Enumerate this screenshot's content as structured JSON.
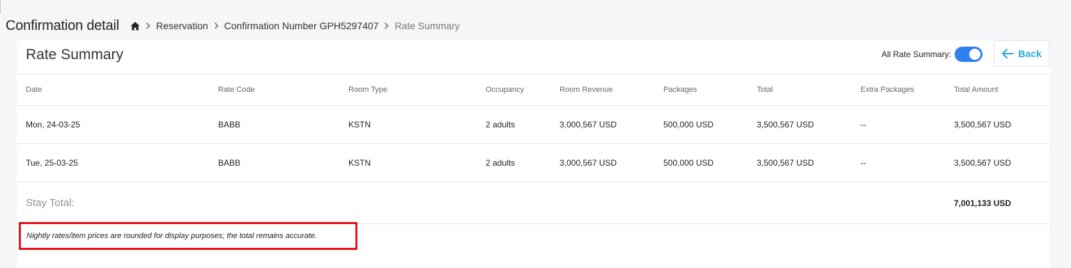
{
  "header": {
    "page_title": "Confirmation detail",
    "breadcrumb": [
      "Reservation",
      "Confirmation Number GPH5297407",
      "Rate Summary"
    ]
  },
  "card": {
    "title": "Rate Summary",
    "toggle_label": "All Rate Summary:",
    "toggle_on": true,
    "back_label": "Back",
    "accent_color": "#2f80ed",
    "back_color": "#29a8e0"
  },
  "table": {
    "columns": [
      "Date",
      "Rate Code",
      "Room Type",
      "Occupancy",
      "Room Revenue",
      "Packages",
      "Total",
      "Extra Packages",
      "Total Amount"
    ],
    "rows": [
      [
        "Mon, 24-03-25",
        "BABB",
        "KSTN",
        "2 adults",
        "3,000,567 USD",
        "500,000 USD",
        "3,500,567 USD",
        "--",
        "3,500,567 USD"
      ],
      [
        "Tue, 25-03-25",
        "BABB",
        "KSTN",
        "2 adults",
        "3,000,567 USD",
        "500,000 USD",
        "3,500,567 USD",
        "--",
        "3,500,567 USD"
      ]
    ],
    "stay_total_label": "Stay Total:",
    "stay_total_value": "7,001,133 USD"
  },
  "note": {
    "text": "Nightly rates/item prices are rounded for display purposes; the total remains accurate.",
    "highlight_color": "#e8131a"
  },
  "icons": {
    "home": "home-icon",
    "separator": "chevron-right-icon",
    "back": "arrow-left-icon"
  }
}
